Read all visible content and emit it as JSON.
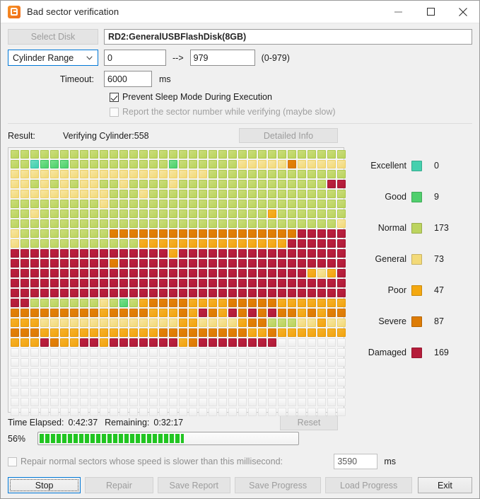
{
  "window": {
    "title": "Bad sector verification",
    "icon": "app-logo-icon",
    "minimize": "─",
    "maximize": "☐",
    "close": "✕"
  },
  "toolbar": {
    "select_disk_label": "Select Disk",
    "disk_value": "RD2:GeneralUSBFlashDisk(8GB)"
  },
  "range": {
    "mode_label": "Cylinder Range",
    "start_value": "0",
    "arrow": "-->",
    "end_value": "979",
    "hint": "(0-979)"
  },
  "timeout": {
    "label": "Timeout:",
    "value": "6000",
    "unit": "ms"
  },
  "options": {
    "prevent_sleep_label": "Prevent Sleep Mode During Execution",
    "prevent_sleep_checked": true,
    "report_sector_label": "Report the sector number while verifying (maybe slow)",
    "report_sector_checked": false
  },
  "result": {
    "label": "Result:",
    "value": "Verifying Cylinder:558",
    "detailed_info_label": "Detailed Info"
  },
  "legend": {
    "items": [
      {
        "name": "Excellent",
        "count": "0",
        "color": "#45d0ae"
      },
      {
        "name": "Good",
        "count": "9",
        "color": "#50cf6d"
      },
      {
        "name": "Normal",
        "count": "173",
        "color": "#bcd45f"
      },
      {
        "name": "General",
        "count": "73",
        "color": "#f3da79"
      },
      {
        "name": "Poor",
        "count": "47",
        "color": "#f4a810"
      },
      {
        "name": "Severe",
        "count": "87",
        "color": "#dd7c06"
      },
      {
        "name": "Damaged",
        "count": "169",
        "color": "#b51d3a"
      }
    ]
  },
  "progress": {
    "time_elapsed_label": "Time Elapsed:",
    "time_elapsed_value": "0:42:37",
    "remaining_label": "Remaining:",
    "remaining_value": "0:32:17",
    "reset_label": "Reset",
    "percent_label": "56%",
    "percent_value": 56,
    "bar_color": "#21c521"
  },
  "repair": {
    "checkbox_label": "Repair normal sectors whose speed is slower than this millisecond:",
    "checked": false,
    "ms_value": "3590",
    "ms_unit": "ms"
  },
  "buttons": {
    "stop": "Stop",
    "repair": "Repair",
    "save_report": "Save Report",
    "save_progress": "Save Progress",
    "load_progress": "Load Progress",
    "exit": "Exit"
  },
  "sector_grid": {
    "columns": 34,
    "rows": 27,
    "scanned_rows": 17,
    "palette": [
      "#45d0ae",
      "#50cf6d",
      "#bcd45f",
      "#f3da79",
      "#f4a810",
      "#dd7c06",
      "#b51d3a"
    ],
    "cells": [
      "2222222222222222222222222222222222",
      "2201112222222222122222233333533333",
      "3333333333333333333322222222222222",
      "3323232332232222322222222222222266",
      "3333333333222322222222222222222222",
      "2222222223222222222222222222222222",
      "2232222222222222222222222242222222",
      "2222222222222222222222222222222223",
      "3222222222555555555555555555566666",
      "3222222222222444444444444444666666",
      "6666666666666666466666666666666666",
      "6666666666566666666666666666666666",
      "6666666666666666666666666666664346",
      "6666666666666666666666666666666666",
      "6666666666666666666666666666666666",
      "6622222223212455554444555554444444",
      "5555555554555544454654656565545455",
      "4443333333333333344333345522233433",
      "5554444444444445555555554454444444",
      "4446544664666666645666666669999999"
    ]
  }
}
